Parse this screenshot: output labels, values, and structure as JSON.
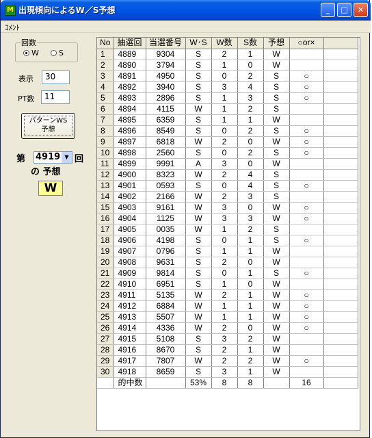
{
  "window": {
    "title": "出現傾向によるW／S予想",
    "icon_text": "M",
    "minimize": "_",
    "maximize": "□",
    "close": "✕"
  },
  "menu": {
    "comment": "ｺﾒﾝﾄ"
  },
  "left": {
    "group_label": "回数",
    "radio_w": "W",
    "radio_s": "S",
    "selected": "W",
    "display_label": "表示",
    "display_value": "30",
    "pt_label": "PT数",
    "pt_value": "11",
    "pattern_button": "パターンWS\n予想",
    "round_prefix": "第",
    "round_value": "4919",
    "round_suffix": "回",
    "prediction_label": "の 予想",
    "prediction_value": "W"
  },
  "table": {
    "headers": [
      "No",
      "抽選回",
      "当選番号",
      "W･S",
      "W数",
      "S数",
      "予想",
      "○or×"
    ],
    "rows": [
      [
        "1",
        "4889",
        "9304",
        "S",
        "2",
        "1",
        "W",
        ""
      ],
      [
        "2",
        "4890",
        "3794",
        "S",
        "1",
        "0",
        "W",
        ""
      ],
      [
        "3",
        "4891",
        "4950",
        "S",
        "0",
        "2",
        "S",
        "○"
      ],
      [
        "4",
        "4892",
        "3940",
        "S",
        "3",
        "4",
        "S",
        "○"
      ],
      [
        "5",
        "4893",
        "2896",
        "S",
        "1",
        "3",
        "S",
        "○"
      ],
      [
        "6",
        "4894",
        "4115",
        "W",
        "1",
        "2",
        "S",
        ""
      ],
      [
        "7",
        "4895",
        "6359",
        "S",
        "1",
        "1",
        "W",
        ""
      ],
      [
        "8",
        "4896",
        "8549",
        "S",
        "0",
        "2",
        "S",
        "○"
      ],
      [
        "9",
        "4897",
        "6818",
        "W",
        "2",
        "0",
        "W",
        "○"
      ],
      [
        "10",
        "4898",
        "2560",
        "S",
        "0",
        "2",
        "S",
        "○"
      ],
      [
        "11",
        "4899",
        "9991",
        "A",
        "3",
        "0",
        "W",
        ""
      ],
      [
        "12",
        "4900",
        "8323",
        "W",
        "2",
        "4",
        "S",
        ""
      ],
      [
        "13",
        "4901",
        "0593",
        "S",
        "0",
        "4",
        "S",
        "○"
      ],
      [
        "14",
        "4902",
        "2166",
        "W",
        "2",
        "3",
        "S",
        ""
      ],
      [
        "15",
        "4903",
        "9161",
        "W",
        "3",
        "0",
        "W",
        "○"
      ],
      [
        "16",
        "4904",
        "1125",
        "W",
        "3",
        "3",
        "W",
        "○"
      ],
      [
        "17",
        "4905",
        "0035",
        "W",
        "1",
        "2",
        "S",
        ""
      ],
      [
        "18",
        "4906",
        "4198",
        "S",
        "0",
        "1",
        "S",
        "○"
      ],
      [
        "19",
        "4907",
        "0796",
        "S",
        "1",
        "1",
        "W",
        ""
      ],
      [
        "20",
        "4908",
        "9631",
        "S",
        "2",
        "0",
        "W",
        ""
      ],
      [
        "21",
        "4909",
        "9814",
        "S",
        "0",
        "1",
        "S",
        "○"
      ],
      [
        "22",
        "4910",
        "6951",
        "S",
        "1",
        "0",
        "W",
        ""
      ],
      [
        "23",
        "4911",
        "5135",
        "W",
        "2",
        "1",
        "W",
        "○"
      ],
      [
        "24",
        "4912",
        "6884",
        "W",
        "1",
        "1",
        "W",
        "○"
      ],
      [
        "25",
        "4913",
        "5507",
        "W",
        "1",
        "1",
        "W",
        "○"
      ],
      [
        "26",
        "4914",
        "4336",
        "W",
        "2",
        "0",
        "W",
        "○"
      ],
      [
        "27",
        "4915",
        "5108",
        "S",
        "3",
        "2",
        "W",
        ""
      ],
      [
        "28",
        "4916",
        "8670",
        "S",
        "2",
        "1",
        "W",
        ""
      ],
      [
        "29",
        "4917",
        "7807",
        "W",
        "2",
        "2",
        "W",
        "○"
      ],
      [
        "30",
        "4918",
        "8659",
        "S",
        "3",
        "1",
        "W",
        ""
      ]
    ],
    "footer": [
      "",
      "的中数",
      "",
      "53%",
      "8",
      "8",
      "",
      "16"
    ]
  }
}
